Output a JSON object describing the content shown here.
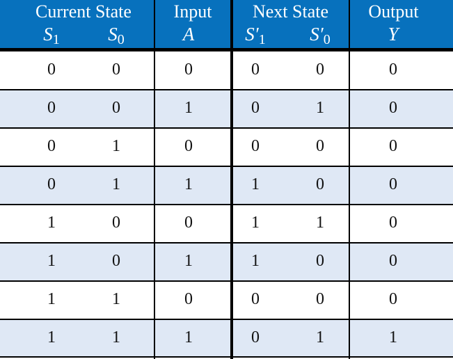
{
  "header": {
    "groups": [
      "Current State",
      "Input",
      "Next State",
      "Output"
    ],
    "symbols": [
      {
        "base": "S",
        "sub": "1"
      },
      {
        "base": "S",
        "sub": "0"
      },
      {
        "base": "A",
        "sub": ""
      },
      {
        "base": "S′",
        "sub": "1"
      },
      {
        "base": "S′",
        "sub": "0"
      },
      {
        "base": "Y",
        "sub": ""
      }
    ]
  },
  "rows": [
    [
      "0",
      "0",
      "0",
      "0",
      "0",
      "0"
    ],
    [
      "0",
      "0",
      "1",
      "0",
      "1",
      "0"
    ],
    [
      "0",
      "1",
      "0",
      "0",
      "0",
      "0"
    ],
    [
      "0",
      "1",
      "1",
      "1",
      "0",
      "0"
    ],
    [
      "1",
      "0",
      "0",
      "1",
      "1",
      "0"
    ],
    [
      "1",
      "0",
      "1",
      "1",
      "0",
      "0"
    ],
    [
      "1",
      "1",
      "0",
      "0",
      "0",
      "0"
    ],
    [
      "1",
      "1",
      "1",
      "0",
      "1",
      "1"
    ]
  ],
  "colors": {
    "header": "#0771bd",
    "stripe": "#dfe8f5",
    "text": "#111111"
  }
}
